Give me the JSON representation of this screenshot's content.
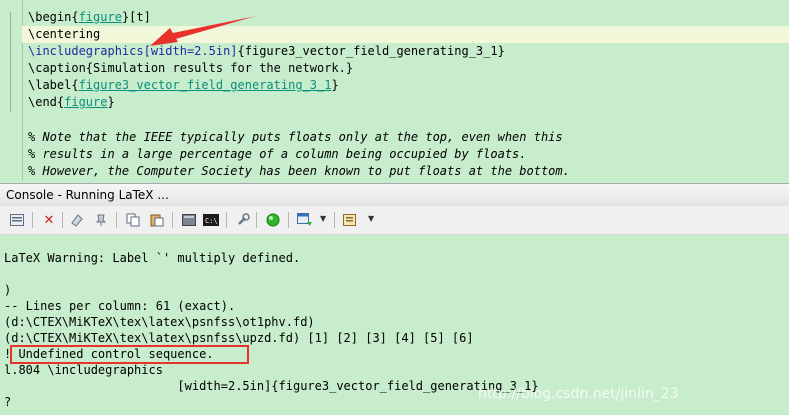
{
  "editor": {
    "lines": [
      {
        "pre": "\\begin{",
        "mid": "figure",
        "post": "}[t]"
      },
      {
        "text": "\\centering"
      },
      {
        "kw": "\\includegraphics",
        "opt": "[width=2.5in]",
        "post": "{figure3_vector_field_generating_3_1}"
      },
      {
        "text": "\\caption{Simulation results for the network.}"
      },
      {
        "pre": "\\label{",
        "mid": "figure3_vector_field_generating_3_1",
        "post": "}"
      },
      {
        "pre": "\\end{",
        "mid": "figure",
        "post": "}"
      },
      {
        "text": ""
      },
      {
        "text": "% Note that the IEEE typically puts floats only at the top, even when this"
      },
      {
        "text": "% results in a large percentage of a column being occupied by floats."
      },
      {
        "text": "% However, the Computer Society has been known to put floats at the bottom."
      }
    ]
  },
  "console": {
    "title": "Console - Running LaTeX ...",
    "lines": [
      "",
      "LaTeX Warning: Label `' multiply defined.",
      "",
      ")",
      "-- Lines per column: 61 (exact).",
      "(d:\\CTEX\\MiKTeX\\tex\\latex\\psnfss\\ot1phv.fd)",
      "(d:\\CTEX\\MiKTeX\\tex\\latex\\psnfss\\upzd.fd) [1] [2] [3] [4] [5] [6]",
      "! Undefined control sequence.",
      "l.804 \\includegraphics",
      "                        [width=2.5in]{figure3_vector_field_generating_3_1}",
      "?"
    ]
  },
  "toolbar": {
    "icons": [
      "console-window-icon",
      "close-icon",
      "clear-icon",
      "pin-icon",
      "copy-icon",
      "paste-icon",
      "display-icon",
      "terminal-icon",
      "wrench-icon",
      "run-icon",
      "open-console-icon",
      "display-selected-console-icon"
    ]
  },
  "watermark": "http://blog.csdn.net/jinlin_23",
  "colors": {
    "background": "#c7edcc",
    "highlight_line": "#f2f7d9",
    "annotation_red": "#e8322b"
  }
}
